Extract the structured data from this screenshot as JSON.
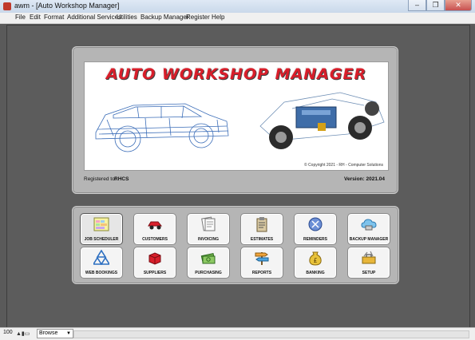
{
  "window": {
    "title": "awm - [Auto Workshop Manager]"
  },
  "window_controls": {
    "minimize": "–",
    "restore": "❐",
    "close": "✕"
  },
  "menu": [
    "File",
    "Edit",
    "Format",
    "Additional Services",
    "Utilities",
    "Backup Manager",
    "Register",
    "Help"
  ],
  "banner": {
    "title": "AUTO WORKSHOP MANAGER",
    "copyright": "© Copyright 2021 - RH - Computer Solutions"
  },
  "registration": {
    "label": "Registered to:",
    "value": "RHCS",
    "version": "Version: 2021.04"
  },
  "tiles": [
    {
      "label": "JOB SCHEDULER",
      "icon": "calendar-icon",
      "selected": true
    },
    {
      "label": "CUSTOMERS",
      "icon": "car-icon"
    },
    {
      "label": "INVOICING",
      "icon": "invoice-icon"
    },
    {
      "label": "ESTIMATES",
      "icon": "clipboard-icon"
    },
    {
      "label": "REMINDERS",
      "icon": "reminder-icon"
    },
    {
      "label": "BACKUP MANAGER",
      "icon": "cloud-icon"
    },
    {
      "label": "WEB BOOKINGS",
      "icon": "triangles-icon"
    },
    {
      "label": "SUPPLIERS",
      "icon": "box-icon"
    },
    {
      "label": "PURCHASING",
      "icon": "money-icon"
    },
    {
      "label": "REPORTS",
      "icon": "signpost-icon"
    },
    {
      "label": "BANKING",
      "icon": "moneybag-icon"
    },
    {
      "label": "SETUP",
      "icon": "toolbox-icon"
    }
  ],
  "status": {
    "zoom": "100",
    "mode": "Browse"
  },
  "colors": {
    "accent": "#d81e2a",
    "background": "#5a5a5a",
    "panel": "#b5b5b5"
  }
}
